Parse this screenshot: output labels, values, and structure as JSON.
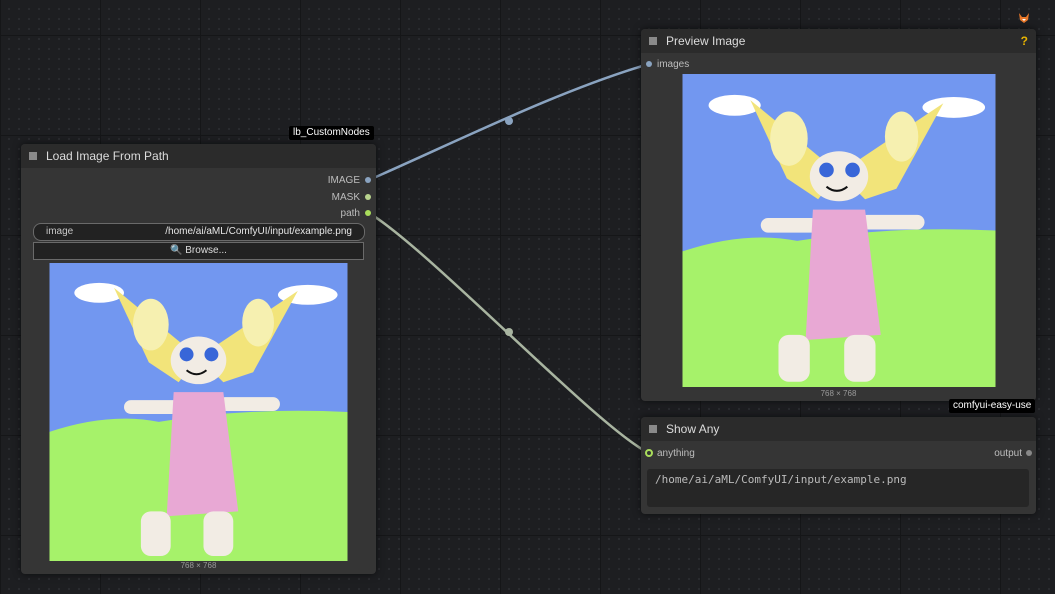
{
  "nodes": {
    "load": {
      "title": "Load Image From Path",
      "badge": "lb_CustomNodes",
      "outputs": [
        "IMAGE",
        "MASK",
        "path"
      ],
      "image_widget": {
        "label": "image",
        "value": "/home/ai/aML/ComfyUI/input/example.png"
      },
      "browse_label": "Browse...",
      "image_size": "768 × 768"
    },
    "preview": {
      "title": "Preview Image",
      "input": "images",
      "help_label": "?",
      "image_size": "768 × 768"
    },
    "show": {
      "title": "Show Any",
      "badge": "comfyui-easy-use",
      "input": "anything",
      "output": "output",
      "text": "/home/ai/aML/ComfyUI/input/example.png"
    }
  },
  "colors": {
    "image_link": "#8aa3c0",
    "string_link": "#a8b4a0",
    "sky": "#7297f0",
    "grass": "#a6f26a",
    "dress": "#e8a8d4",
    "hair": "#f2e47a"
  },
  "icons": [
    "search-icon",
    "fox-icon"
  ]
}
